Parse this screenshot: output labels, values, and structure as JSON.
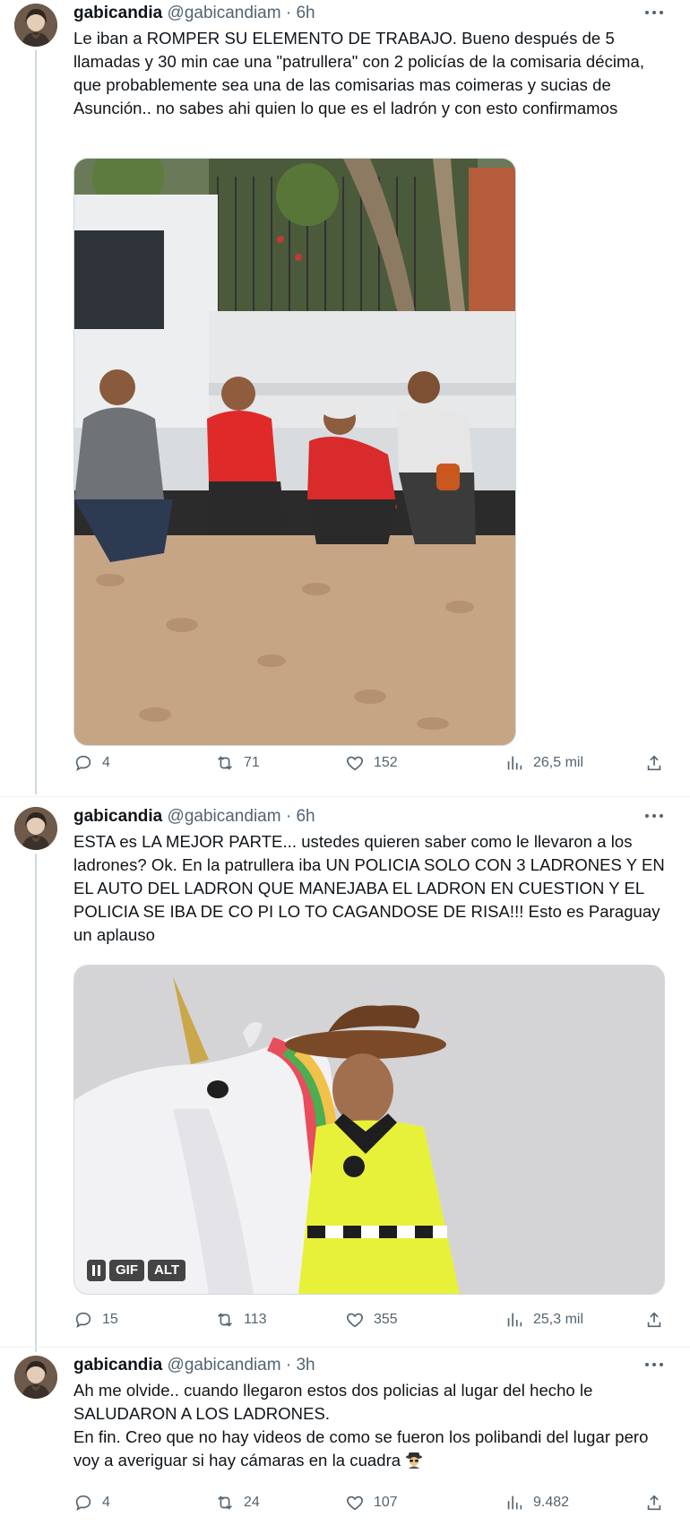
{
  "tweets": [
    {
      "name": "gabicandia",
      "handle": "@gabicandiam",
      "separator": "·",
      "time": "6h",
      "text": "Le iban a ROMPER SU ELEMENTO DE TRABAJO. Bueno después de 5 llamadas y 30 min cae una \"patrullera\" con 2 policías de la comisaria décima, que probablemente sea una de las comisarias mas coimeras y sucias de Asunción.. no sabes ahi quien lo que es el ladrón y con esto confirmamos",
      "replies": "4",
      "retweets": "71",
      "likes": "152",
      "views": "26,5 mil"
    },
    {
      "name": "gabicandia",
      "handle": "@gabicandiam",
      "separator": "·",
      "time": "6h",
      "text": "ESTA es LA MEJOR PARTE... ustedes quieren saber como le llevaron a los ladrones? Ok. En la patrullera iba UN POLICIA SOLO CON 3 LADRONES Y EN EL AUTO DEL LADRON QUE MANEJABA EL LADRON EN CUESTION Y EL POLICIA SE IBA DE CO PI LO TO CAGANDOSE DE RISA!!! Esto es Paraguay un aplauso",
      "gif_label": "GIF",
      "alt_label": "ALT",
      "replies": "15",
      "retweets": "113",
      "likes": "355",
      "views": "25,3 mil"
    },
    {
      "name": "gabicandia",
      "handle": "@gabicandiam",
      "separator": "·",
      "time": "3h",
      "text": "Ah me olvide.. cuando llegaron estos dos policias al lugar del hecho le SALUDARON A LOS LADRONES.\nEn fin. Creo que no hay videos de como se fueron los polibandi del lugar pero voy a averiguar si hay cámaras en la cuadra",
      "emoji": "spy-emoji",
      "replies": "4",
      "retweets": "24",
      "likes": "107",
      "views": "9.482"
    }
  ],
  "icons": {
    "reply": "reply-icon",
    "retweet": "retweet-icon",
    "like": "heart-icon",
    "views": "views-icon",
    "share": "share-icon",
    "more": "more-icon"
  },
  "colors": {
    "text": "#0f1419",
    "secondary": "#536471",
    "border": "#cfd9de"
  }
}
